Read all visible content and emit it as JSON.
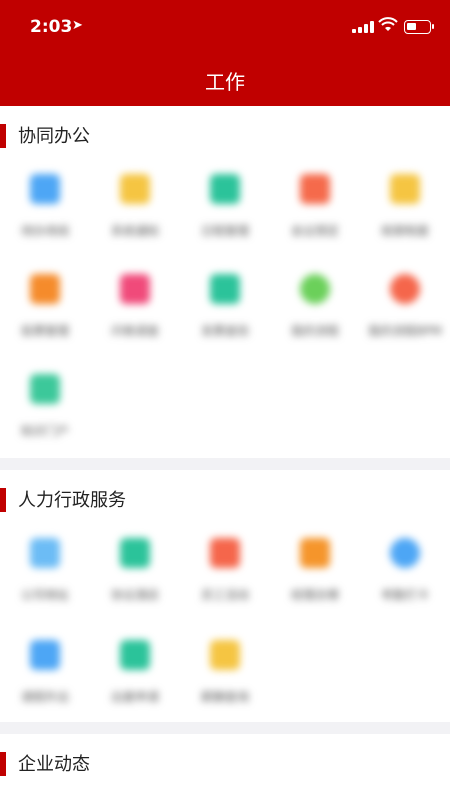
{
  "status_bar": {
    "time": "2:03",
    "location_icon": "location-arrow-icon",
    "signal_icon": "cellular-signal-icon",
    "wifi_icon": "wifi-icon",
    "battery_icon": "battery-icon"
  },
  "header": {
    "title": "工作"
  },
  "colors": {
    "brand_red": "#c00000",
    "background": "#f2f2f5"
  },
  "sections": [
    {
      "title": "协同办公",
      "items": [
        {
          "label": "待办待阅",
          "color": "#4da6f5",
          "icon": "bookmark-icon"
        },
        {
          "label": "系统通知",
          "color": "#f5c542",
          "icon": "message-icon"
        },
        {
          "label": "日程管理",
          "color": "#2bc39a",
          "icon": "calendar-icon"
        },
        {
          "label": "会议预定",
          "color": "#f56a4b",
          "icon": "meeting-icon"
        },
        {
          "label": "规章制度",
          "color": "#f5c542",
          "icon": "document-icon"
        },
        {
          "label": "投票管理",
          "color": "#f58b2b",
          "icon": "vote-icon"
        },
        {
          "label": "问卷调查",
          "color": "#f04a7a",
          "icon": "clipboard-icon"
        },
        {
          "label": "发票查验",
          "color": "#2bc39a",
          "icon": "invoice-icon"
        },
        {
          "label": "我的流程",
          "color": "#6bd05a",
          "icon": "flow-icon"
        },
        {
          "label": "我的流程BPM",
          "color": "#f5664b",
          "icon": "bpm-flow-icon"
        },
        {
          "label": "知识门户",
          "color": "#3cc89a",
          "icon": "book-icon"
        }
      ]
    },
    {
      "title": "人力行政服务",
      "items": [
        {
          "label": "公司地址",
          "color": "#6cbcf5",
          "icon": "map-pin-icon"
        },
        {
          "label": "协议酒店",
          "color": "#2bc39a",
          "icon": "hotel-icon"
        },
        {
          "label": "员工活动",
          "color": "#f5664b",
          "icon": "gift-icon"
        },
        {
          "label": "经理去哪",
          "color": "#f5952b",
          "icon": "person-icon"
        },
        {
          "label": "考勤打卡",
          "color": "#4da6f5",
          "icon": "clock-icon"
        },
        {
          "label": "请假外出",
          "color": "#4da6f5",
          "icon": "person-leave-icon"
        },
        {
          "label": "出差申请",
          "color": "#2bc39a",
          "icon": "trip-icon"
        },
        {
          "label": "薪酬查询",
          "color": "#f5c542",
          "icon": "search-icon"
        }
      ]
    },
    {
      "title": "企业动态",
      "items": []
    }
  ]
}
